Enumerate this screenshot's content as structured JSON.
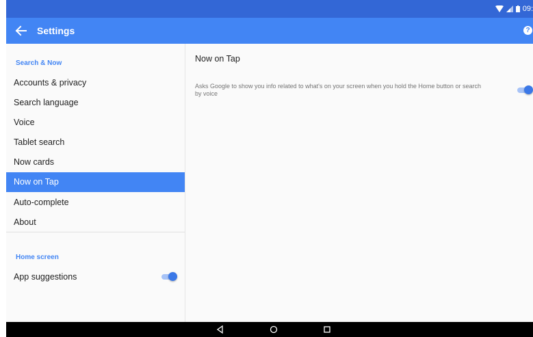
{
  "status_bar": {
    "time": "09:"
  },
  "app_bar": {
    "title": "Settings",
    "back_icon": "arrow-left-icon",
    "help_icon": "help-circle-icon",
    "help_glyph": "?"
  },
  "colors": {
    "status_bar": "#3367d6",
    "app_bar": "#4285f4",
    "accent": "#4285f4",
    "selected_bg": "#4285f4"
  },
  "sidebar": {
    "sections": [
      {
        "header": "Search & Now",
        "items": [
          {
            "label": "Accounts & privacy"
          },
          {
            "label": "Search language"
          },
          {
            "label": "Voice"
          },
          {
            "label": "Tablet search"
          },
          {
            "label": "Now cards"
          },
          {
            "label": "Now on Tap",
            "selected": true
          },
          {
            "label": "Auto-complete"
          },
          {
            "label": "About"
          }
        ]
      },
      {
        "header": "Home screen",
        "items": [
          {
            "label": "App suggestions",
            "toggle": true,
            "on": true
          }
        ]
      }
    ]
  },
  "detail": {
    "title": "Now on Tap",
    "description": "Asks Google to show you info related to what's on your screen when you hold the Home button or search by voice",
    "toggle_on": true
  },
  "nav_bar": {
    "back_icon": "triangle-back-icon",
    "home_icon": "circle-home-icon",
    "recents_icon": "square-recents-icon"
  }
}
